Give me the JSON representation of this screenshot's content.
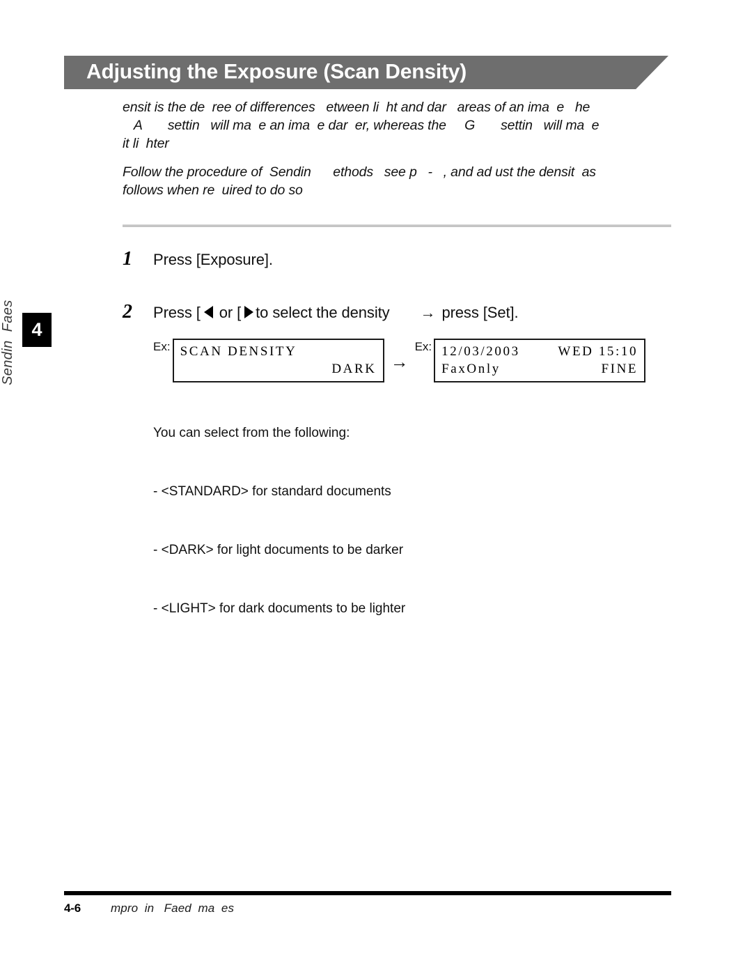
{
  "header": {
    "title": "Adjusting the Exposure (Scan Density)"
  },
  "sidebar": {
    "chapter_number": "4",
    "chapter_label": "Sendin  Faes"
  },
  "intro": {
    "paragraph_1": "ensit is the de  ree of differences   etween li  ht and dar   areas of an ima  e   he\n   A       settin   will ma  e an ima  e dar  er, whereas the     G       settin   will ma  e\nit li  hter",
    "paragraph_2": "Follow the procedure of  Sendin      ethods   see p   -   , and ad ust the densit  as\nfollows when re  uired to do so"
  },
  "steps": [
    {
      "number": "1",
      "text": "Press [Exposure]."
    },
    {
      "number": "2",
      "text_before_left_arrow": "Press [",
      "text_between_arrows": " or [",
      "text_after_right_arrow": "to select the density",
      "transition_arrow": "→",
      "text_tail": "press [Set]."
    }
  ],
  "lcd_examples": {
    "ex_label": "Ex:",
    "transition_arrow": "→",
    "before": {
      "line1_left": "SCAN DENSITY",
      "line1_right": "",
      "line2_left": "",
      "line2_right": "DARK"
    },
    "after": {
      "line1_left": "12/03/2003",
      "line1_right": "WED 15:10",
      "line2_left": "FaxOnly",
      "line2_right": "FINE"
    }
  },
  "notes": {
    "intro_line": "You can select from the following:",
    "items": [
      "- <STANDARD> for standard documents",
      "- <DARK> for light documents to be darker",
      "- <LIGHT> for dark documents to be lighter"
    ]
  },
  "footer": {
    "page_number": "4-6",
    "chapter_title": "mpro  in   Faed  ma  es"
  },
  "colors": {
    "banner_gray": "#6e6e6e",
    "divider_gray": "#c4c4c4",
    "tab_black": "#000000",
    "text_black": "#111111"
  }
}
